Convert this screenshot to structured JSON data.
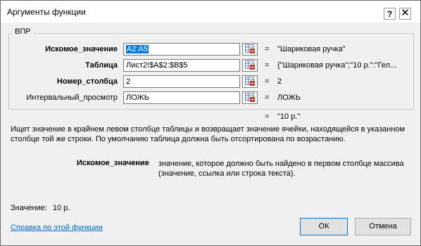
{
  "window": {
    "title": "Аргументы функции",
    "help_glyph": "?",
    "close_glyph": "✕"
  },
  "function_group": {
    "name": "ВПР",
    "rows": [
      {
        "label": "Искомое_значение",
        "bold": true,
        "value": "A2:A5",
        "equals": "=",
        "result": "\"Шариковая ручка\""
      },
      {
        "label": "Таблица",
        "bold": true,
        "value": "Лист2!$A$2:$B$5",
        "equals": "=",
        "result": "{\"Шариковая ручка\";\"10 р.\":\"Гел..."
      },
      {
        "label": "Номер_столбца",
        "bold": true,
        "value": "2",
        "equals": "=",
        "result": "2"
      },
      {
        "label": "Интервальный_просмотр",
        "bold": false,
        "value": "ЛОЖЬ",
        "equals": "=",
        "result": "ЛОЖЬ"
      }
    ],
    "overall_equals": "=",
    "overall_result": "\"10 р.\""
  },
  "description": "Ищет значение в крайнем левом столбце таблицы и возвращает значение ячейки, находящейся в указанном столбце той же строки. По умолчанию таблица должна быть отсортирована по возрастанию.",
  "argument_help": {
    "name": "Искомое_значение",
    "text": "значение, которое должно быть найдено в первом столбце массива (значение, ссылка или строка текста)."
  },
  "value_label": "Значение:",
  "value": "10 р.",
  "help_link": "Справка по этой функции",
  "buttons": {
    "ok": "ОК",
    "cancel": "Отмена"
  },
  "icons": {
    "ref_button": "collapse-dialog-icon"
  }
}
